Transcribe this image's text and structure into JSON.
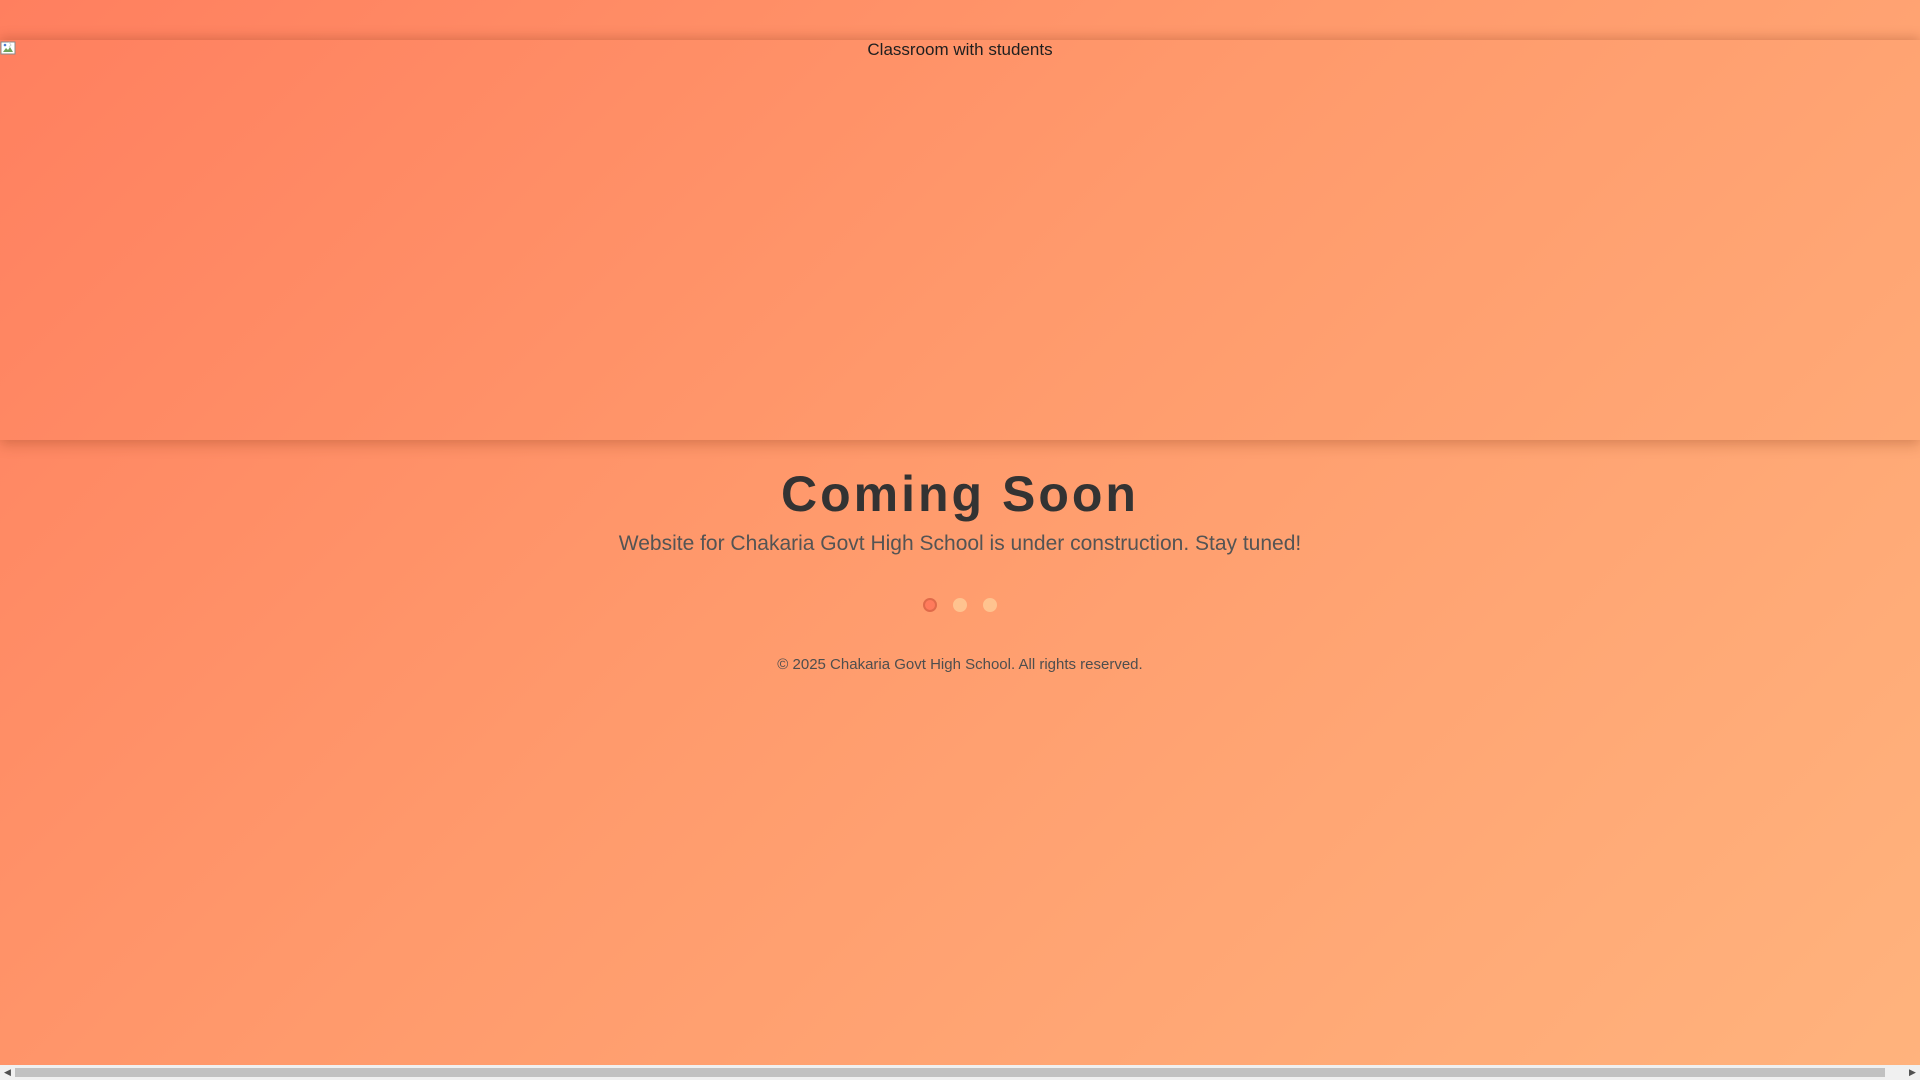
{
  "hero": {
    "image_alt": "Classroom with students",
    "broken_icon": "broken-image-icon"
  },
  "main": {
    "title": "Coming Soon",
    "subtitle": "Website for Chakaria Govt High School is under construction. Stay tuned!",
    "loader": {
      "dot_count": 3,
      "active_index": 0
    },
    "footer": "© 2025 Chakaria Govt High School. All rights reserved."
  },
  "scrollbar": {
    "left_arrow": "◀",
    "right_arrow": "▶",
    "left_icon": "arrow-left-icon",
    "right_icon": "arrow-right-icon"
  },
  "colors": {
    "gradient_start": "#ff7f5f",
    "gradient_end": "#ffb37d",
    "title": "#333333",
    "subtitle": "#545454",
    "dot_active": "#ff7b5c",
    "dot_idle": "#ffc38f"
  }
}
